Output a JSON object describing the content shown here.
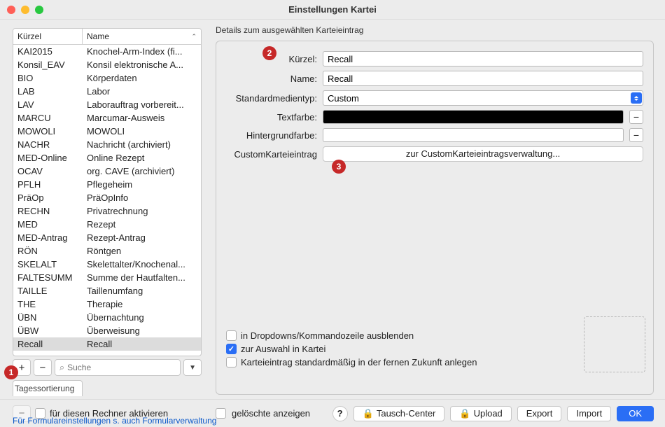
{
  "window": {
    "title": "Einstellungen Kartei"
  },
  "sidebar": {
    "columns": {
      "kuerzel": "Kürzel",
      "name": "Name"
    },
    "rows": [
      {
        "k": "KAI2015",
        "n": "Knochel-Arm-Index (fi..."
      },
      {
        "k": "Konsil_EAV",
        "n": "Konsil elektronische A..."
      },
      {
        "k": "BIO",
        "n": "Körperdaten"
      },
      {
        "k": "LAB",
        "n": "Labor"
      },
      {
        "k": "LAV",
        "n": "Laborauftrag vorbereit..."
      },
      {
        "k": "MARCU",
        "n": "Marcumar-Ausweis"
      },
      {
        "k": "MOWOLI",
        "n": "MOWOLI"
      },
      {
        "k": "NACHR",
        "n": "Nachricht (archiviert)"
      },
      {
        "k": "MED-Online",
        "n": "Online Rezept"
      },
      {
        "k": "OCAV",
        "n": "org. CAVE (archiviert)"
      },
      {
        "k": "PFLH",
        "n": "Pflegeheim"
      },
      {
        "k": "PräOp",
        "n": "PräOpInfo"
      },
      {
        "k": "RECHN",
        "n": "Privatrechnung"
      },
      {
        "k": "MED",
        "n": "Rezept"
      },
      {
        "k": "MED-Antrag",
        "n": "Rezept-Antrag"
      },
      {
        "k": "RÖN",
        "n": "Röntgen"
      },
      {
        "k": "SKELALT",
        "n": "Skelettalter/Knochenal..."
      },
      {
        "k": "FALTESUMM",
        "n": "Summe der Hautfalten..."
      },
      {
        "k": "TAILLE",
        "n": "Taillenumfang"
      },
      {
        "k": "THE",
        "n": "Therapie"
      },
      {
        "k": "ÜBN",
        "n": "Übernachtung"
      },
      {
        "k": "ÜBW",
        "n": "Überweisung"
      },
      {
        "k": "Recall",
        "n": "Recall",
        "sel": true
      }
    ],
    "search_placeholder": "Suche",
    "tagessortierung": "Tagessortierung"
  },
  "details": {
    "header": "Details zum ausgewählten Karteieintrag",
    "labels": {
      "kuerzel": "Kürzel:",
      "name": "Name:",
      "medientyp": "Standardmedientyp:",
      "textfarbe": "Textfarbe:",
      "hintergrundfarbe": "Hintergrundfarbe:",
      "custom": "CustomKarteieintrag"
    },
    "values": {
      "kuerzel": "Recall",
      "name": "Recall",
      "medientyp": "Custom",
      "custom_link": "zur CustomKarteieintragsverwaltung..."
    },
    "checks": {
      "hide": "in Dropdowns/Kommandozeile ausblenden",
      "auswahl": "zur Auswahl in Kartei",
      "zukunft": "Karteieintrag standardmäßig in der fernen Zukunft anlegen"
    }
  },
  "footer": {
    "rechner": "für diesen Rechner aktivieren",
    "geloeschte": "gelöschte anzeigen",
    "tausch": "Tausch-Center",
    "upload": "Upload",
    "export": "Export",
    "import": "Import",
    "ok": "OK",
    "link": "Für Formulareinstellungen s. auch Formularverwaltung"
  },
  "callouts": {
    "c1": "1",
    "c2": "2",
    "c3": "3"
  }
}
